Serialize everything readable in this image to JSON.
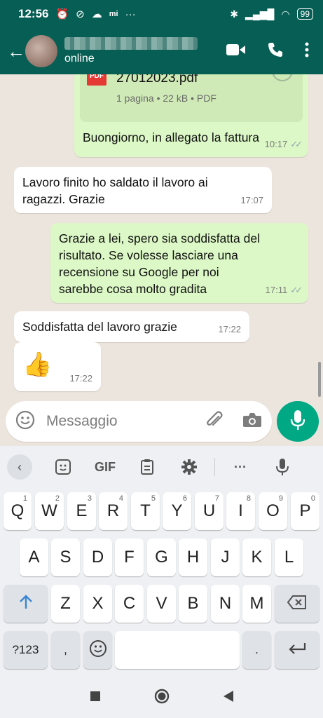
{
  "status_bar": {
    "time": "12:56",
    "battery": "99"
  },
  "header": {
    "status": "online"
  },
  "messages": {
    "m1": {
      "file_name": "27012023.pdf",
      "file_info": "1 pagina • 22 kB • PDF",
      "pdf_icon_label": "PDF",
      "text": "Buongiorno, in allegato la fattura",
      "time": "10:17"
    },
    "m2": {
      "line1": "Lavoro finito ho saldato il lavoro ai",
      "line2": "ragazzi. Grazie",
      "time": "17:07"
    },
    "m3": {
      "line1": "Grazie a lei, spero sia soddisfatta del",
      "line2": "risultato. Se volesse lasciare una",
      "line3": "recensione su Google per noi",
      "line4": "sarebbe cosa molto gradita",
      "time": "17:11"
    },
    "m4": {
      "text": "Soddisfatta del lavoro grazie",
      "time": "17:22"
    },
    "m5": {
      "emoji": "👍",
      "time": "17:22"
    }
  },
  "composer": {
    "placeholder": "Messaggio"
  },
  "keyboard": {
    "toolbar": {
      "gif": "GIF"
    },
    "row1": [
      {
        "k": "Q",
        "h": "1"
      },
      {
        "k": "W",
        "h": "2"
      },
      {
        "k": "E",
        "h": "3"
      },
      {
        "k": "R",
        "h": "4"
      },
      {
        "k": "T",
        "h": "5"
      },
      {
        "k": "Y",
        "h": "6"
      },
      {
        "k": "U",
        "h": "7"
      },
      {
        "k": "I",
        "h": "8"
      },
      {
        "k": "O",
        "h": "9"
      },
      {
        "k": "P",
        "h": "0"
      }
    ],
    "row2": [
      "A",
      "S",
      "D",
      "F",
      "G",
      "H",
      "J",
      "K",
      "L"
    ],
    "row3": [
      "Z",
      "X",
      "C",
      "V",
      "B",
      "N",
      "M"
    ],
    "numbers_key": "?123",
    "comma_key": ",",
    "period_key": "."
  }
}
